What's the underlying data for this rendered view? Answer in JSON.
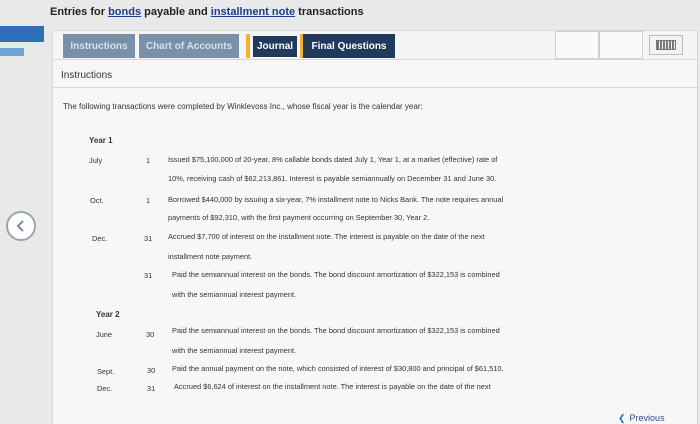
{
  "title": {
    "prefix": "Entries for ",
    "bonds": "bonds",
    "mid": " payable and ",
    "note": "installment note",
    "suffix": " transactions"
  },
  "tabs": [
    {
      "label": "Instructions"
    },
    {
      "label": "Chart of Accounts"
    },
    {
      "label": "Journal"
    },
    {
      "label": "Final Questions"
    }
  ],
  "section_label": "Instructions",
  "intro": "The following transactions were completed by Winklevoss Inc., whose fiscal year is the calendar year:",
  "year1": "Year 1",
  "year2": "Year 2",
  "entries": [
    {
      "month": "July",
      "day": "1",
      "lines": [
        "Issued $75,100,000 of 20-year, 8% callable bonds dated July 1, Year 1, at a market (effective) rate of",
        "10%, receiving cash of $62,213,861. Interest is payable semiannually on December 31 and June 30."
      ]
    },
    {
      "month": "Oct.",
      "day": "1",
      "lines": [
        "Borrowed $440,000 by issuing a six-year, 7% installment note to Nicks Bank. The note requires annual",
        "payments of $92,310, with the first payment occurring on September 30, Year 2."
      ]
    },
    {
      "month": "Dec.",
      "day": "31",
      "lines": [
        "Accrued $7,700 of interest on the installment note. The interest is payable on the date of the next",
        "installment note payment."
      ]
    },
    {
      "month": "",
      "day": "31",
      "lines": [
        "Paid the semiannual interest on the bonds. The bond discount amortization of $322,153 is combined",
        "with the semiannual interest payment."
      ]
    },
    {
      "month": "June",
      "day": "30",
      "lines": [
        "Paid the semiannual interest on the bonds. The bond discount amortization of $322,153 is combined",
        "with the semiannual interest payment."
      ]
    },
    {
      "month": "Sept.",
      "day": "30",
      "lines": [
        "Paid the annual payment on the note, which consisted of interest of $30,800 and principal of $61,510."
      ]
    },
    {
      "month": "Dec.",
      "day": "31",
      "lines": [
        "Accrued $6,624 of interest on the installment note. The interest is payable on the date of the next"
      ]
    }
  ],
  "previous_label": "Previous",
  "colors": {
    "accent_orange": "#f7b035",
    "nav_dark": "#213a5c",
    "tab_inactive": "#7a8fa8",
    "brand_blue": "#2d6fb8"
  }
}
